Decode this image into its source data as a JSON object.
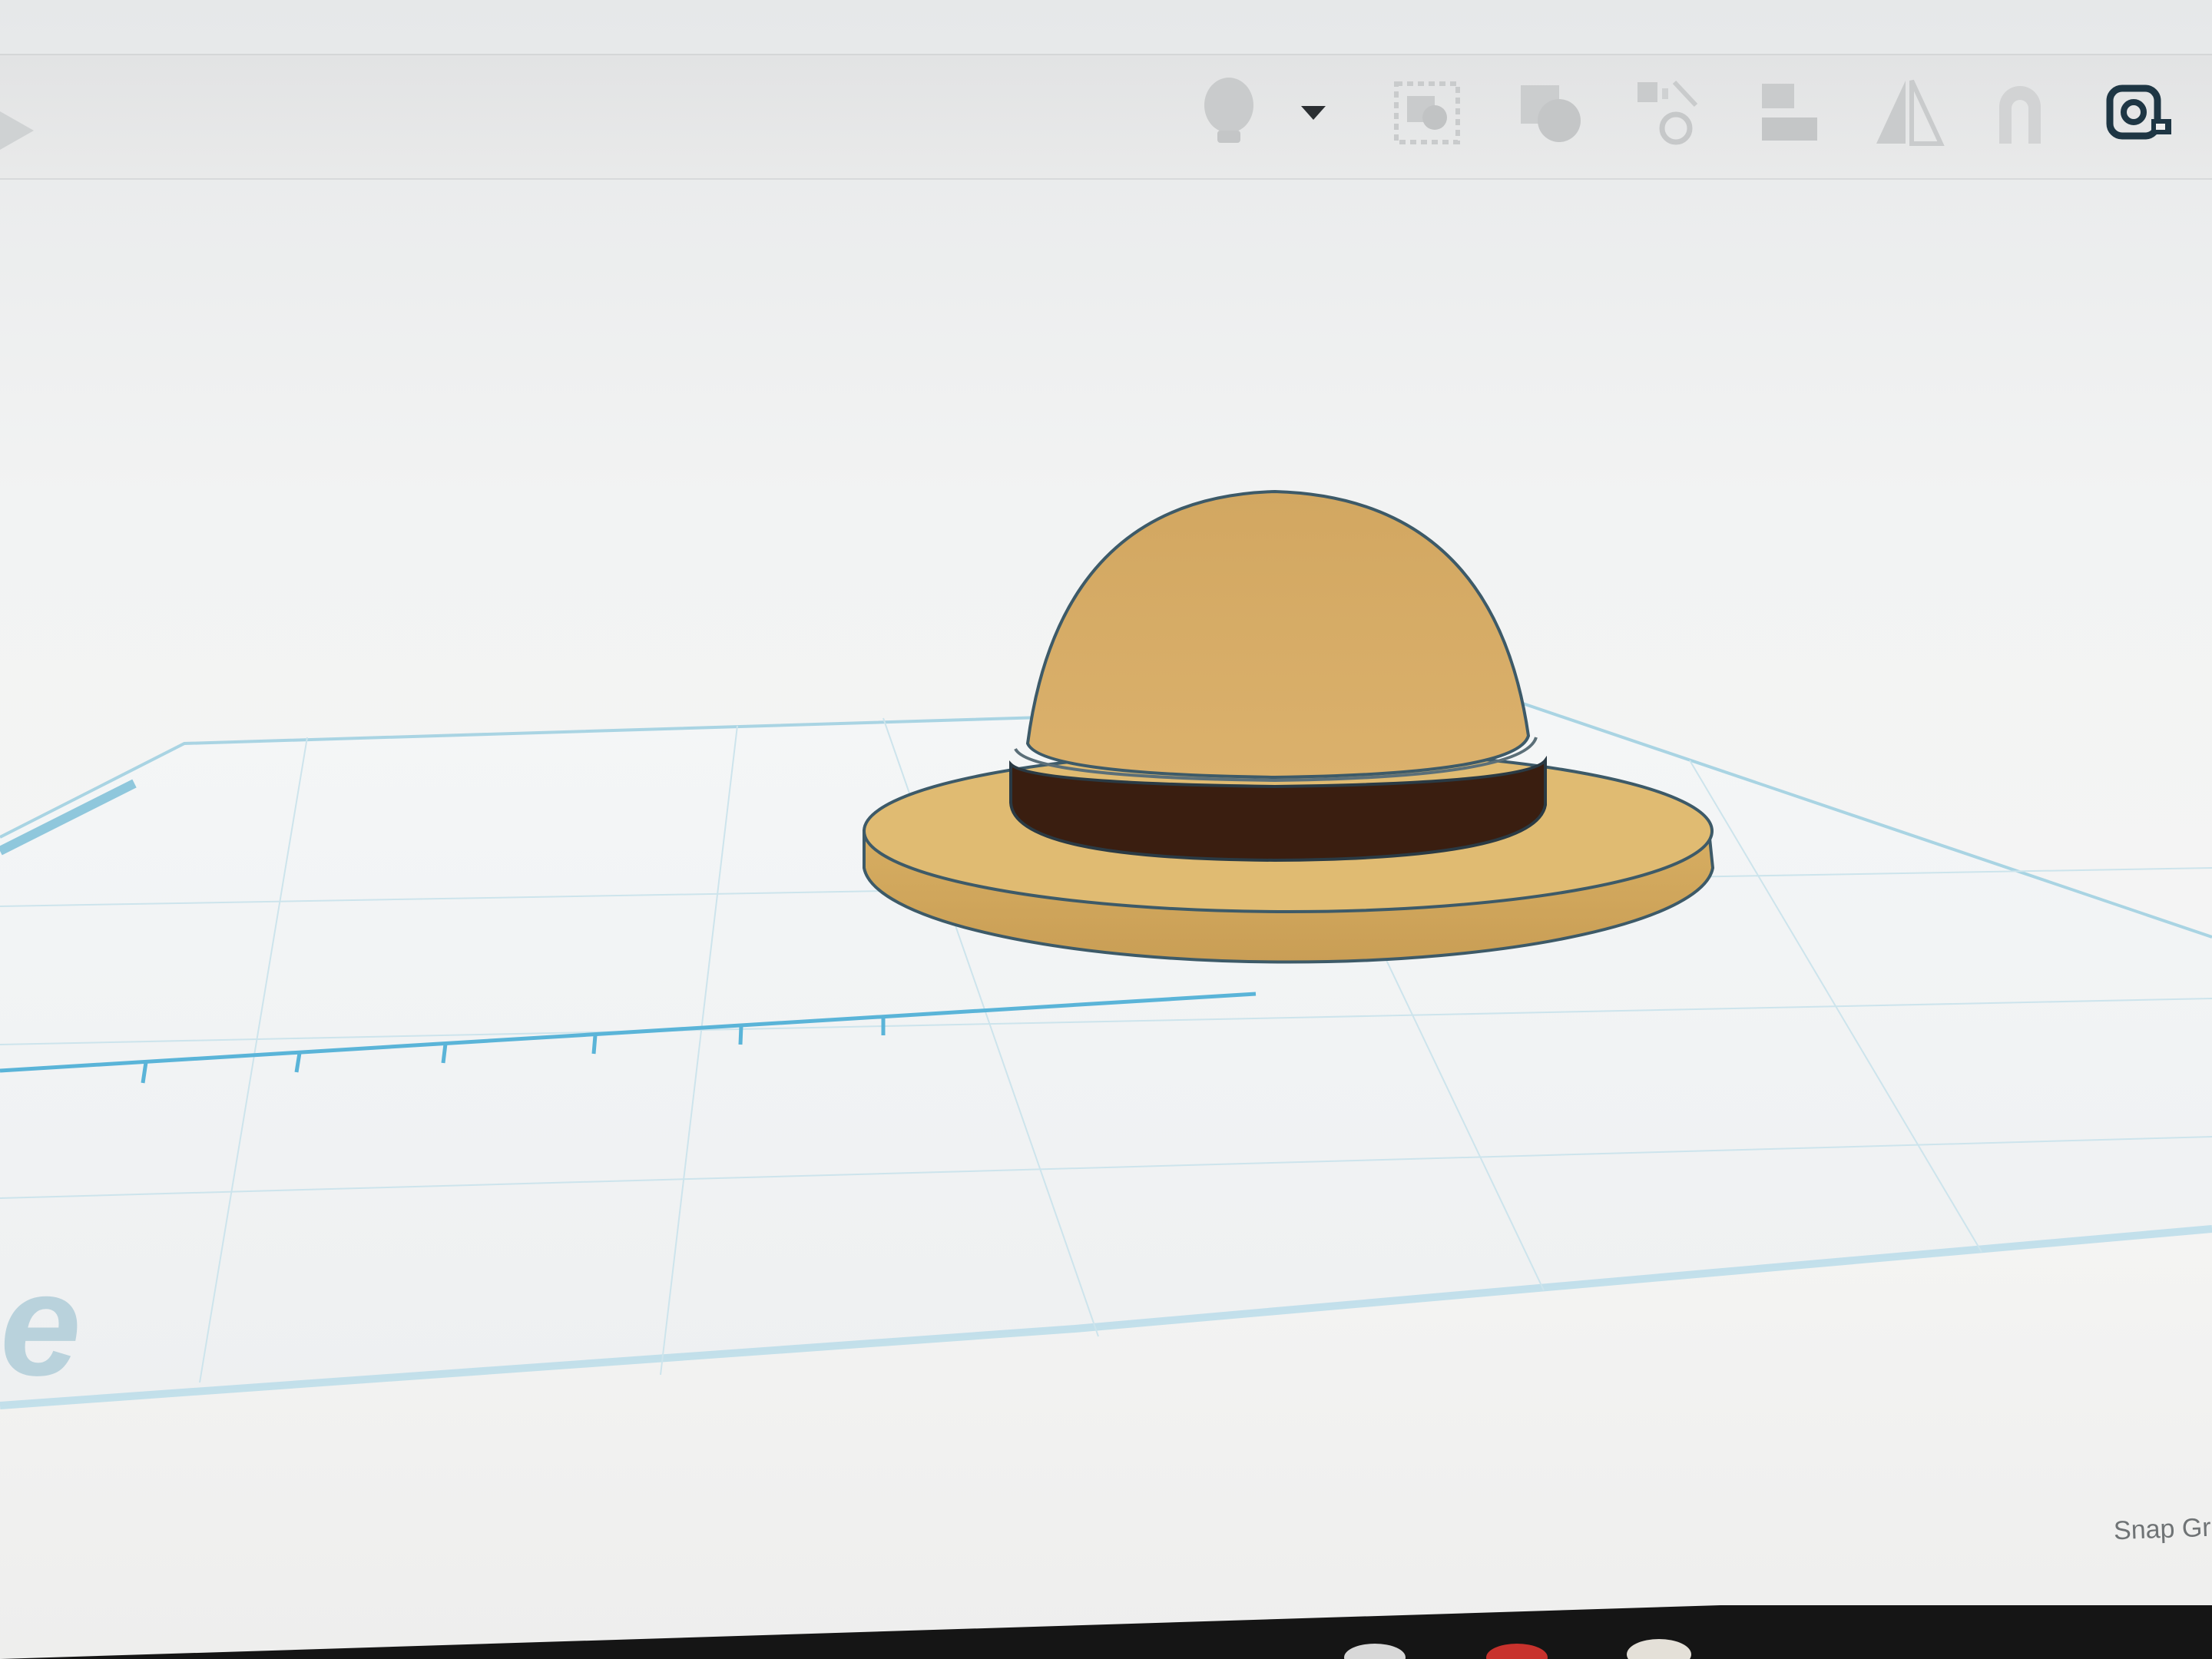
{
  "toolbar": {
    "tools": [
      {
        "icon": "lightbulb-icon"
      },
      {
        "icon": "dropdown-caret-icon"
      },
      {
        "icon": "group-icon"
      },
      {
        "icon": "ungroup-icon"
      },
      {
        "icon": "align-icon"
      },
      {
        "icon": "flip-icon"
      },
      {
        "icon": "mirror-icon"
      },
      {
        "icon": "magnet-icon"
      },
      {
        "icon": "ruler-icon"
      }
    ]
  },
  "workplane": {
    "watermark_letter": "e",
    "snap_grid_label": "Snap Gr"
  },
  "model": {
    "name": "",
    "crown_color": "#d6ac67",
    "band_color": "#3a1e10",
    "brim_color": "#e0bb72",
    "outline_color": "#3d5a68"
  },
  "colors": {
    "grid_line": "#a9d4e3",
    "ruler_line": "#5ab4d8"
  }
}
